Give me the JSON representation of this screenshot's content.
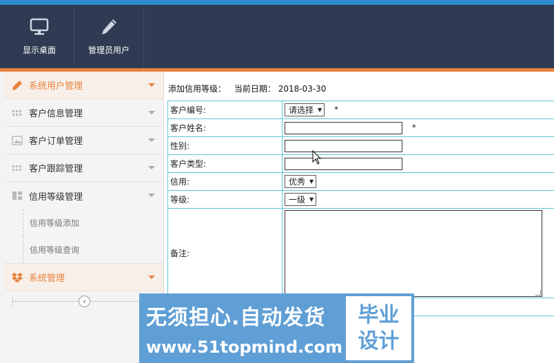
{
  "header": {
    "nav": [
      {
        "label": "显示桌面",
        "icon": "monitor-icon"
      },
      {
        "label": "管理员用户",
        "icon": "pencil-icon"
      }
    ]
  },
  "sidebar": {
    "items": [
      {
        "label": "系统用户管理",
        "icon": "pencil-icon",
        "active": true
      },
      {
        "label": "客户信息管理",
        "icon": "grid-dots-icon"
      },
      {
        "label": "客户订单管理",
        "icon": "image-icon"
      },
      {
        "label": "客户跟踪管理",
        "icon": "grid-dots-icon"
      },
      {
        "label": "信用等级管理",
        "icon": "layout-icon"
      }
    ],
    "sub_items": [
      "信用等级添加",
      "信用等级查询"
    ],
    "system": {
      "label": "系统管理",
      "icon": "dropbox-icon"
    },
    "collapse_glyph": "‹"
  },
  "main": {
    "crumb_title": "添加信用等级：",
    "crumb_date_label": "当前日期：",
    "crumb_date": "2018-03-30",
    "form": {
      "customer_id_label": "客户编号:",
      "customer_id_value": "请选择",
      "customer_name_label": "客户姓名:",
      "gender_label": "性别:",
      "customer_type_label": "客户类型:",
      "credit_label": "信用:",
      "credit_value": "优秀",
      "level_label": "等级:",
      "level_value": "一级",
      "remark_label": "备注:",
      "required_mark": "*"
    }
  },
  "watermark": {
    "line1": "无须担心.自动发货",
    "line2": "www.51topmind.com",
    "right_line1": "毕业",
    "right_line2": "设计"
  },
  "colors": {
    "top_bar": "#2f3b52",
    "accent_orange": "#e8813a",
    "top_border_blue": "#2e8ccf",
    "table_border": "#5fc3d6",
    "watermark_blue": "#5f9fd6"
  }
}
